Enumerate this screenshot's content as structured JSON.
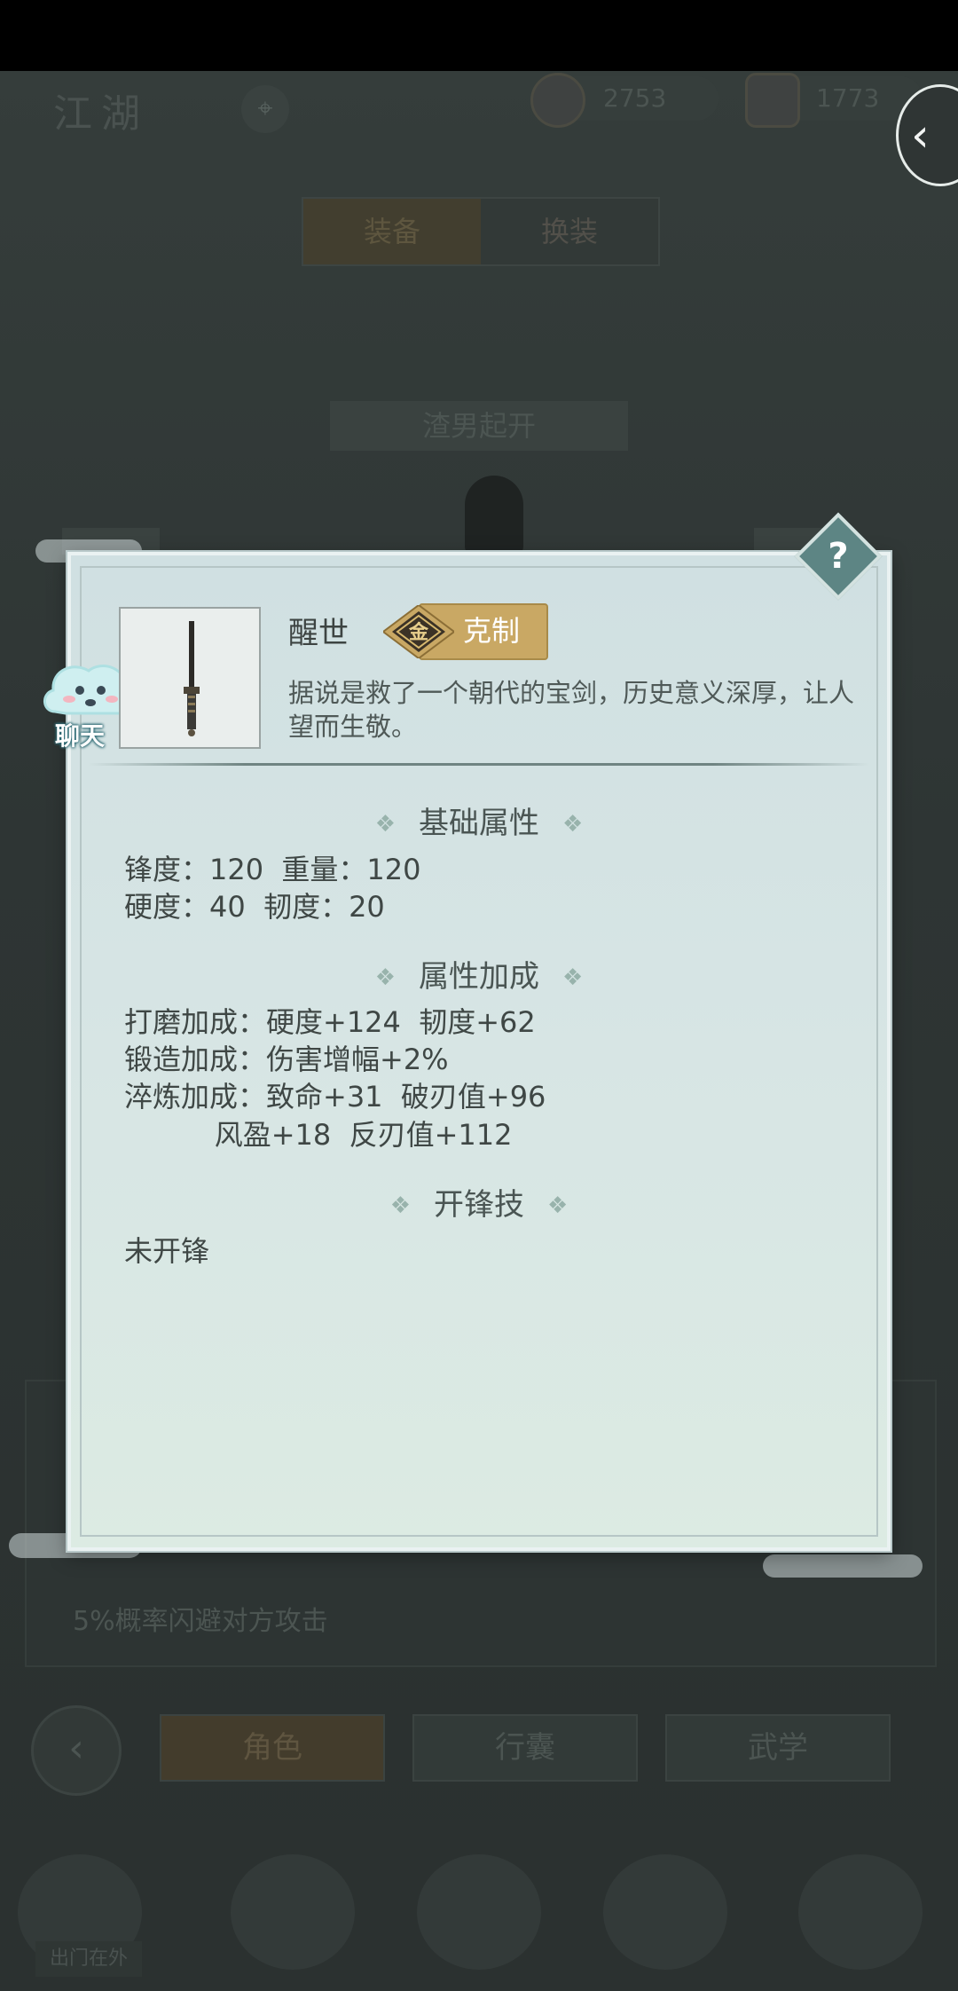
{
  "background": {
    "region_title": "江湖",
    "coins": "2753",
    "gems": "1773",
    "tabs": [
      "装备",
      "换装"
    ],
    "character_name": "渣男起开",
    "footer_text": "5%概率闪避对方攻击",
    "nav": [
      "角色",
      "行囊",
      "武学"
    ],
    "dock_label": "出门在外"
  },
  "chat_bubble": "聊天",
  "item": {
    "name": "醒世",
    "tag_label": "克制",
    "tag_glyph": "金",
    "description": "据说是救了一个朝代的宝剑，历史意义深厚，让人望而生敬。"
  },
  "sections": {
    "basic_title": "基础属性",
    "basic_lines": [
      "锋度：120  重量：120",
      "硬度：40  韧度：20"
    ],
    "bonus_title": "属性加成",
    "bonus_lines": [
      "打磨加成：硬度+124  韧度+62",
      "锻造加成：伤害增幅+2%",
      "淬炼加成：致命+31  破刃值+96",
      "          风盈+18  反刃值+112"
    ],
    "skill_title": "开锋技",
    "skill_text": "未开锋"
  },
  "help_icon": "?",
  "colors": {
    "tag_gold": "#c9a864",
    "help_teal": "#5d8584",
    "panel_bg": "#d7e5e4"
  }
}
